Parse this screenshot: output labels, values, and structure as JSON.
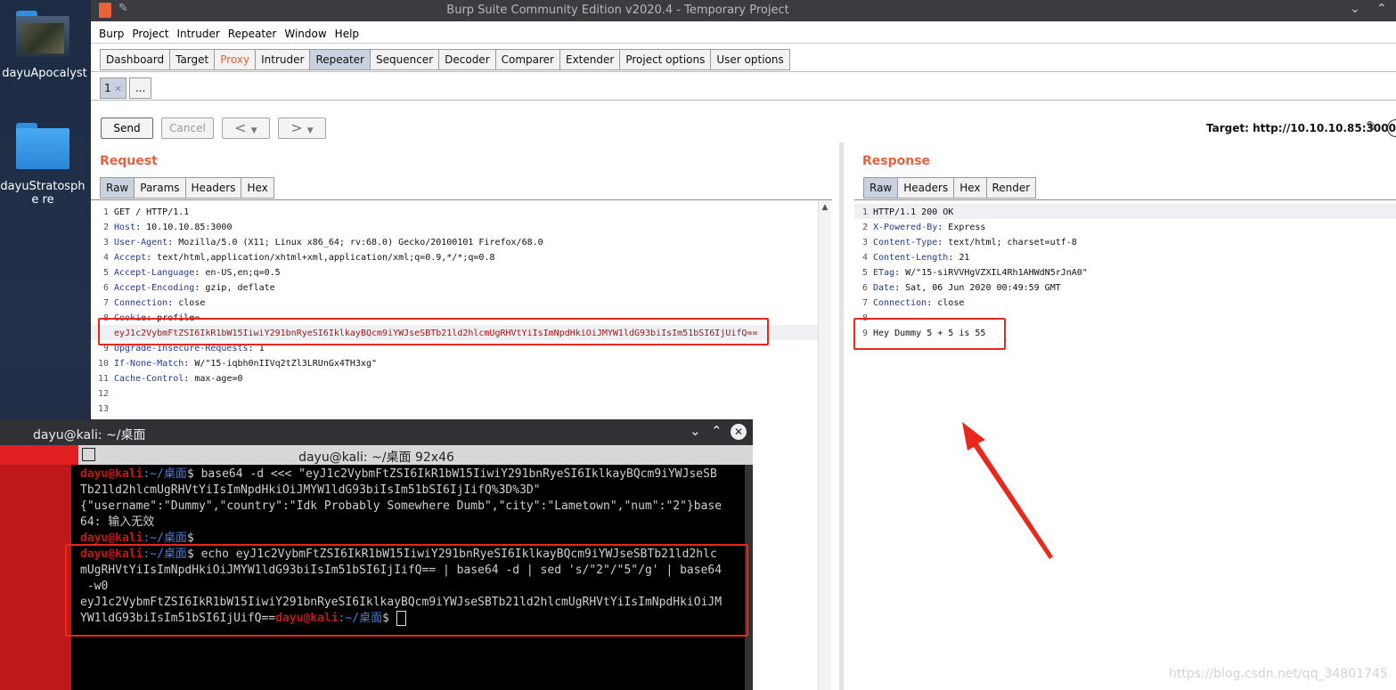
{
  "desktop": {
    "icons": [
      {
        "label": "dayuApocalyst"
      },
      {
        "label": "dayuStratosphe re"
      }
    ]
  },
  "window": {
    "title": "Burp Suite Community Edition v2020.4 - Temporary Project"
  },
  "menu": [
    "Burp",
    "Project",
    "Intruder",
    "Repeater",
    "Window",
    "Help"
  ],
  "main_tabs": [
    "Dashboard",
    "Target",
    "Proxy",
    "Intruder",
    "Repeater",
    "Sequencer",
    "Decoder",
    "Comparer",
    "Extender",
    "Project options",
    "User options"
  ],
  "active_main_tab": "Repeater",
  "repeater_tabs": [
    "1",
    "..."
  ],
  "toolbar": {
    "send": "Send",
    "cancel": "Cancel",
    "back": "<",
    "forward": ">",
    "dropdown": "▼",
    "target_label": "Target: http://10.10.10.85:3000"
  },
  "request": {
    "title": "Request",
    "tabs": [
      "Raw",
      "Params",
      "Headers",
      "Hex"
    ],
    "lines": [
      {
        "n": "1",
        "key": "",
        "val": "GET / HTTP/1.1"
      },
      {
        "n": "2",
        "key": "Host",
        "val": "10.10.10.85:3000"
      },
      {
        "n": "3",
        "key": "User-Agent",
        "val": "Mozilla/5.0 (X11; Linux x86_64; rv:68.0) Gecko/20100101 Firefox/68.0"
      },
      {
        "n": "4",
        "key": "Accept",
        "val": "text/html,application/xhtml+xml,application/xml;q=0.9,*/*;q=0.8"
      },
      {
        "n": "5",
        "key": "Accept-Language",
        "val": "en-US,en;q=0.5"
      },
      {
        "n": "6",
        "key": "Accept-Encoding",
        "val": "gzip, deflate"
      },
      {
        "n": "7",
        "key": "Connection",
        "val": "close"
      },
      {
        "n": "8",
        "key": "Cookie",
        "val": "profile="
      },
      {
        "n": "",
        "key": "",
        "val": "eyJ1c2VybmFtZSI6IkR1bW15IiwiY291bnRyeSI6IklkayBQcm9iYWJseSBTb21ld2hlcmUgRHVtYiIsImNpdHkiOiJMYW1ldG93biIsIm51bSI6IjUifQ=="
      },
      {
        "n": "9",
        "key": "Upgrade-Insecure-Requests",
        "val": "1"
      },
      {
        "n": "10",
        "key": "If-None-Match",
        "val": "W/\"15-iqbh0nIIVq2tZl3LRUnGx4TH3xg\""
      },
      {
        "n": "11",
        "key": "Cache-Control",
        "val": "max-age=0"
      },
      {
        "n": "12",
        "key": "",
        "val": ""
      },
      {
        "n": "13",
        "key": "",
        "val": ""
      }
    ]
  },
  "response": {
    "title": "Response",
    "tabs": [
      "Raw",
      "Headers",
      "Hex",
      "Render"
    ],
    "lines": [
      {
        "n": "1",
        "key": "",
        "val": "HTTP/1.1 200 OK"
      },
      {
        "n": "2",
        "key": "X-Powered-By",
        "val": "Express"
      },
      {
        "n": "3",
        "key": "Content-Type",
        "val": "text/html; charset=utf-8"
      },
      {
        "n": "4",
        "key": "Content-Length",
        "val": "21"
      },
      {
        "n": "5",
        "key": "ETag",
        "val": "W/\"15-siRVVHgVZXIL4Rh1AHWdN5rJnA0\""
      },
      {
        "n": "6",
        "key": "Date",
        "val": "Sat, 06 Jun 2020 00:49:59 GMT"
      },
      {
        "n": "7",
        "key": "Connection",
        "val": "close"
      },
      {
        "n": "8",
        "key": "",
        "val": ""
      },
      {
        "n": "9",
        "key": "",
        "val": "Hey Dummy 5 + 5 is 55"
      }
    ]
  },
  "terminal": {
    "window_title": "dayu@kali: ~/桌面",
    "inner_title": "dayu@kali: ~/桌面 92x46",
    "user": "dayu@kali",
    "path": ":~/桌面",
    "lines": [
      "base64 -d <<< \"eyJ1c2VybmFtZSI6IkR1bW15IiwiY291bnRyeSI6IklkayBQcm9iYWJseSB",
      "Tb21ld2hlcmUgRHVtYiIsImNpdHkiOiJMYW1ldG93biIsIm51bSI6IjIifQ%3D%3D\"",
      "{\"username\":\"Dummy\",\"country\":\"Idk Probably Somewhere Dumb\",\"city\":\"Lametown\",\"num\":\"2\"}base",
      "64: 输入无效",
      "echo eyJ1c2VybmFtZSI6IkR1bW15IiwiY291bnRyeSI6IklkayBQcm9iYWJseSBTb21ld2hlc",
      "mUgRHVtYiIsImNpdHkiOiJMYW1ldG93biIsIm51bSI6IjIifQ== | base64 -d | sed 's/\"2\"/\"5\"/g' | base64",
      " -w0",
      "eyJ1c2VybmFtZSI6IkR1bW15IiwiY291bnRyeSI6IklkayBQcm9iYWJseSBTb21ld2hlcmUgRHVtYiIsImNpdHkiOiJM",
      "YW1ldG93biIsIm51bSI6IjUifQ=="
    ]
  },
  "watermark": "https://blog.csdn.net/qq_34801745"
}
